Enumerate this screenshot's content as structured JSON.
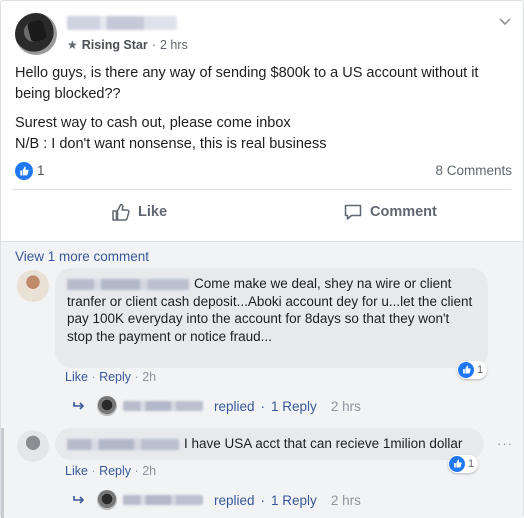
{
  "post": {
    "author_badge": "Rising Star",
    "meta_separator": "·",
    "time": "2 hrs",
    "text_line1": "Hello guys, is there any way of sending $800k to a US account without it being blocked??",
    "text_line2": "Surest way to cash out, please come inbox",
    "text_line3": "N/B : I don't want nonsense, this is real business",
    "like_count": "1",
    "comments_count": "8 Comments",
    "like_label": "Like",
    "comment_label": "Comment"
  },
  "comments": {
    "view_more": "View 1 more comment",
    "c1": {
      "text": "Come make we deal, shey na wire or client tranfer or client cash deposit...Aboki account dey for u...let the client pay 100K everyday into the account for 8days so that they won't stop the payment or notice fraud...",
      "reaction_count": "1",
      "like": "Like",
      "reply": "Reply",
      "time": "2h",
      "replied": "replied",
      "replies": "1 Reply",
      "replied_time": "2 hrs"
    },
    "c2": {
      "text": "I have USA acct that can recieve 1milion dollar",
      "reaction_count": "1",
      "like": "Like",
      "reply": "Reply",
      "time": "2h",
      "replied": "replied",
      "replies": "1 Reply",
      "replied_time": "2 hrs"
    },
    "dot_sep": "·",
    "more_dots": "···"
  },
  "colors": {
    "link": "#385898",
    "like_blue": "#2078f4",
    "muted": "#606770"
  },
  "icons": [
    "star-icon",
    "chevron-down-icon",
    "thumbs-up-icon",
    "comment-icon",
    "reply-arrow-icon"
  ]
}
